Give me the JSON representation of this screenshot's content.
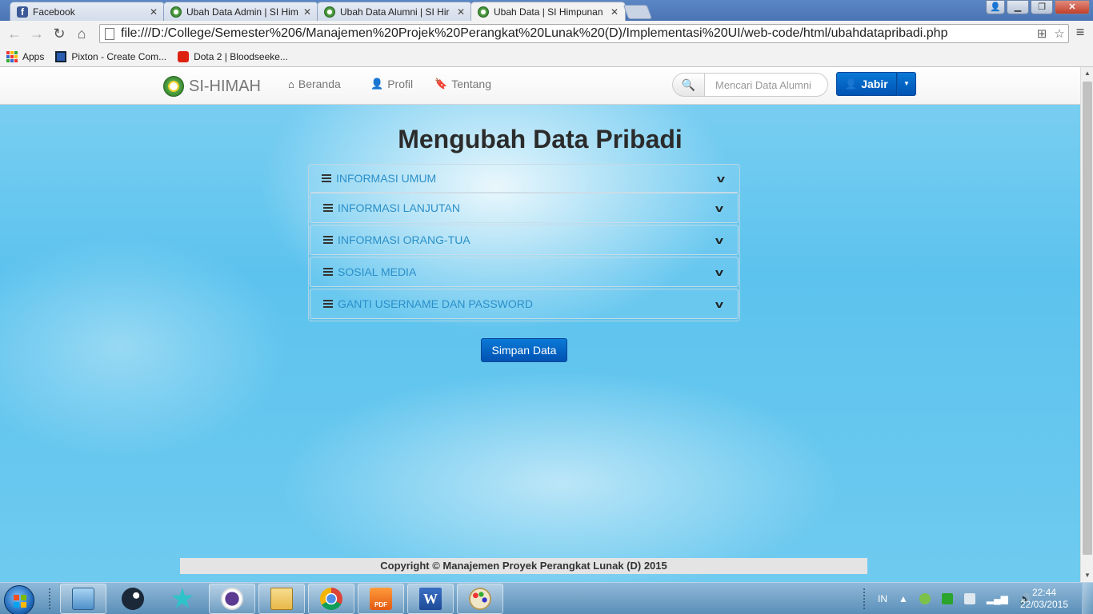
{
  "browser": {
    "tabs": [
      {
        "title": "Facebook",
        "favicon": "facebook-icon",
        "active": false
      },
      {
        "title": "Ubah Data Admin | SI Him",
        "favicon": "himah-logo-icon",
        "active": false
      },
      {
        "title": "Ubah Data Alumni | SI Hir",
        "favicon": "himah-logo-icon",
        "active": false
      },
      {
        "title": "Ubah Data | SI Himpunan",
        "favicon": "himah-logo-icon",
        "active": true
      }
    ],
    "url": "file:///D:/College/Semester%206/Manajemen%20Projek%20Perangkat%20Lunak%20(D)/Implementasi%20UI/web-code/html/ubahdatapribadi.php",
    "bookmarks": [
      {
        "label": "Apps",
        "icon": "apps-grid-icon"
      },
      {
        "label": "Pixton - Create Com...",
        "icon": "pixton-icon"
      },
      {
        "label": "Dota 2 | Bloodseeke...",
        "icon": "youtube-icon"
      }
    ]
  },
  "site": {
    "brand": "SI-HIMAH",
    "nav": [
      {
        "label": "Beranda",
        "icon": "home-icon"
      },
      {
        "label": "Profil",
        "icon": "user-icon"
      },
      {
        "label": "Tentang",
        "icon": "bookmark-icon"
      }
    ],
    "search": {
      "placeholder": "Mencari Data Alumni",
      "value": ""
    },
    "user_button": "Jabir"
  },
  "main": {
    "title": "Mengubah Data Pribadi",
    "sections": [
      {
        "label": "INFORMASI UMUM"
      },
      {
        "label": "INFORMASI LANJUTAN"
      },
      {
        "label": "INFORMASI ORANG-TUA"
      },
      {
        "label": "SOSIAL MEDIA"
      },
      {
        "label": "GANTI USERNAME DAN PASSWORD"
      }
    ],
    "save_button": "Simpan Data"
  },
  "footer": {
    "text": "Copyright © Manajemen Proyek Perangkat Lunak (D) 2015"
  },
  "taskbar": {
    "apps": [
      "windows-explorer-icon",
      "steam-icon",
      "star-app-icon",
      "cat-app-icon",
      "file-folder-icon",
      "chrome-icon",
      "foxit-pdf-icon",
      "word-icon",
      "paint-icon"
    ],
    "language": "IN",
    "time": "22:44",
    "date": "22/03/2015"
  },
  "colors": {
    "accent": "#0a67c8",
    "link": "#2a8fc9",
    "background_sky": "#5cc3ee"
  }
}
